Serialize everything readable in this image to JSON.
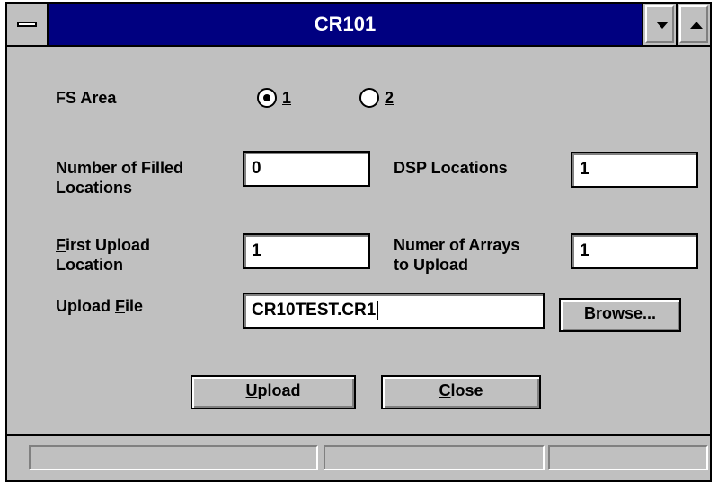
{
  "window": {
    "title": "CR101"
  },
  "fs_area": {
    "label": "FS Area",
    "options": [
      {
        "label": "1",
        "selected": true
      },
      {
        "label": "2",
        "selected": false
      }
    ]
  },
  "fields": {
    "filled_locations": {
      "label_line1": "Number of Filled",
      "label_line2": "Locations",
      "value": "0"
    },
    "dsp_locations": {
      "label": "DSP Locations",
      "value": "1"
    },
    "first_upload": {
      "label_line1_prefix": "F",
      "label_line1_rest": "irst Upload",
      "label_line2": "Location",
      "value": "1"
    },
    "arrays_to_upload": {
      "label_line1": "Numer of Arrays",
      "label_line2": "to Upload",
      "value": "1"
    },
    "upload_file": {
      "label_prefix": "Upload ",
      "label_u": "F",
      "label_rest": "ile",
      "value": "CR10TEST.CR1"
    }
  },
  "buttons": {
    "browse": {
      "u": "B",
      "rest": "rowse..."
    },
    "upload": {
      "u": "U",
      "rest": "pload"
    },
    "close": {
      "u": "C",
      "rest": "lose"
    }
  },
  "colors": {
    "titlebar": "#000080",
    "face": "#c0c0c0"
  }
}
